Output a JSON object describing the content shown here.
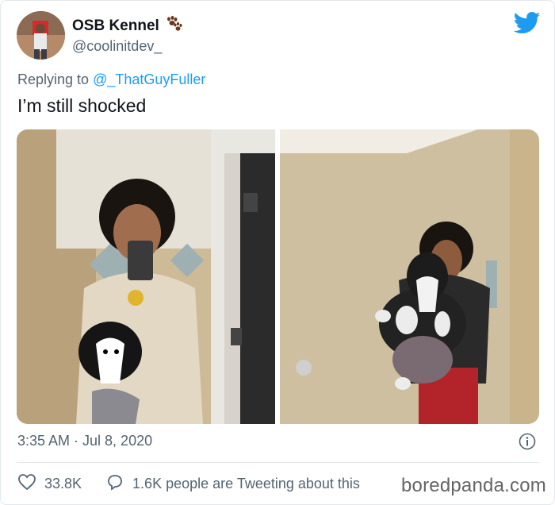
{
  "tweet": {
    "display_name": "OSB Kennel",
    "handle": "@coolinitdev_",
    "name_badge_icon": "paw-prints-icon",
    "replying_label": "Replying to",
    "replying_to": "@_ThatGuyFuller",
    "text": "I’m still shocked",
    "timestamp": "3:35 AM · Jul 8, 2020",
    "likes": "33.8K",
    "tweeting_text": "1.6K people are Tweeting about this",
    "images": [
      {
        "description": "mirror-selfie-holding-puppy"
      },
      {
        "description": "mirror-selfie-holding-grown-dog"
      }
    ]
  },
  "watermark": "boredpanda.com",
  "colors": {
    "twitter_blue": "#1d9bf0",
    "muted_text": "#536471",
    "text": "#0f1419"
  }
}
